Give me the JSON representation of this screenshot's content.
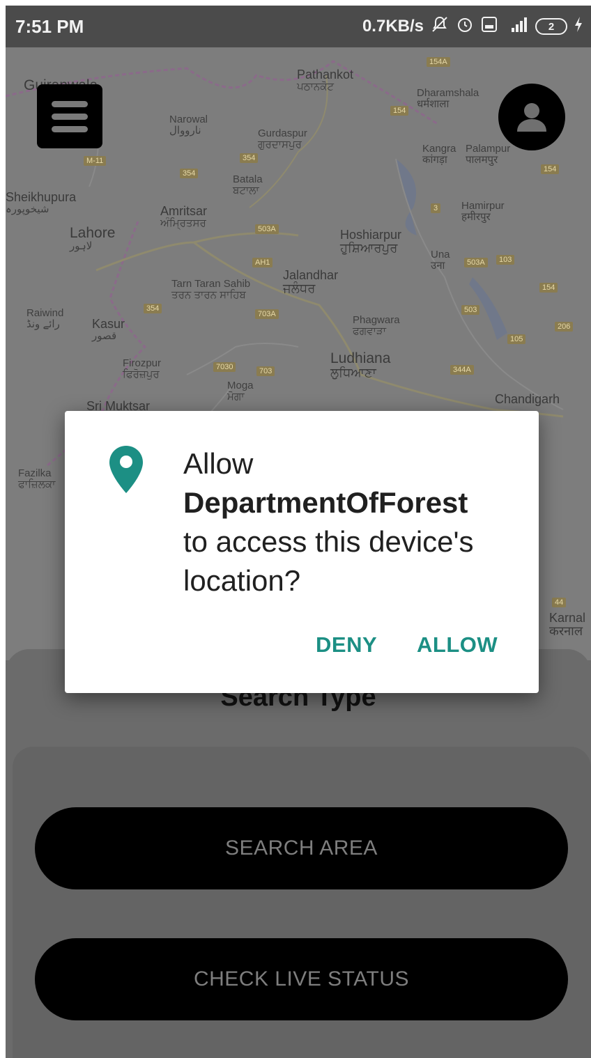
{
  "status_bar": {
    "time": "7:51 PM",
    "net_speed": "0.7KB/s",
    "battery": "2",
    "icons": [
      "mute-notification-icon",
      "alarm-icon",
      "volte-icon",
      "signal-4g-icon",
      "battery-icon",
      "charging-icon"
    ]
  },
  "map": {
    "places": [
      {
        "en": "Gujranwala",
        "loc": ""
      },
      {
        "en": "Pathankot",
        "loc": "ਪਠਾਨਕੋਟ"
      },
      {
        "en": "Dharamshala",
        "loc": "धर्मशाला"
      },
      {
        "en": "Narowal",
        "loc": "نارووال"
      },
      {
        "en": "Gurdaspur",
        "loc": "ਗੁਰਦਾਸਪੁਰ"
      },
      {
        "en": "Kangra",
        "loc": "कांगड़ा"
      },
      {
        "en": "Palampur",
        "loc": "पालमपुर"
      },
      {
        "en": "Batala",
        "loc": "ਬਟਾਲਾ"
      },
      {
        "en": "Sheikhupura",
        "loc": "شیخوپورہ"
      },
      {
        "en": "Amritsar",
        "loc": "ਅੰਮ੍ਰਿਤਸਰ"
      },
      {
        "en": "Hamirpur",
        "loc": "हमीरपुर"
      },
      {
        "en": "Lahore",
        "loc": "لاہور"
      },
      {
        "en": "Hoshiarpur",
        "loc": "ਹੁਸ਼ਿਆਰਪੁਰ"
      },
      {
        "en": "Una",
        "loc": "उना"
      },
      {
        "en": "Jalandhar",
        "loc": "ਜਲੰਧਰ"
      },
      {
        "en": "Tarn Taran Sahib",
        "loc": "ਤਰਨ ਤਾਰਨ ਸਾਹਿਬ"
      },
      {
        "en": "Raiwind",
        "loc": "رائے ونڈ"
      },
      {
        "en": "Kasur",
        "loc": "قصور"
      },
      {
        "en": "Phagwara",
        "loc": "ਫਗਵਾੜਾ"
      },
      {
        "en": "Firozpur",
        "loc": "ਫਿਰੋਜ਼ਪੁਰ"
      },
      {
        "en": "Ludhiana",
        "loc": "ਲੁਧਿਆਣਾ"
      },
      {
        "en": "Moga",
        "loc": "ਮੋਗਾ"
      },
      {
        "en": "Chandigarh",
        "loc": ""
      },
      {
        "en": "Sri Muktsar",
        "loc": ""
      },
      {
        "en": "Fazilka",
        "loc": "ਫਾਜ਼ਿਲਕਾ"
      },
      {
        "en": "Karnal",
        "loc": "करनाल"
      }
    ],
    "road_shields": [
      "154A",
      "154",
      "M-11",
      "354",
      "354",
      "3",
      "503A",
      "AH1",
      "503A",
      "103",
      "154",
      "703A",
      "503",
      "206",
      "105",
      "7030",
      "703",
      "344A",
      "44",
      "354",
      "154"
    ]
  },
  "header": {
    "menu_icon": "hamburger-menu-icon",
    "profile_icon": "user-profile-icon"
  },
  "sheet": {
    "title": "Search Type",
    "buttons": {
      "search_area": "SEARCH AREA",
      "check_live_status": "CHECK LIVE STATUS"
    }
  },
  "dialog": {
    "icon": "location-pin-icon",
    "prefix": "Allow",
    "app_name": "DepartmentOfForest",
    "suffix": "to access this device's location?",
    "deny": "DENY",
    "allow": "ALLOW",
    "accent": "#1c8f84"
  }
}
